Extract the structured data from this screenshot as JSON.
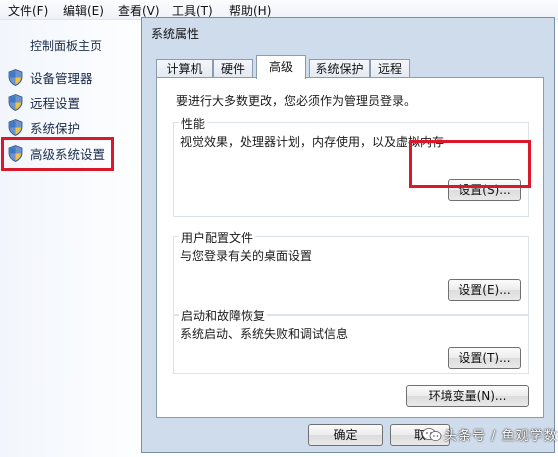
{
  "menubar": {
    "items": [
      "文件(F)",
      "编辑(E)",
      "查看(V)",
      "工具(T)",
      "帮助(H)"
    ]
  },
  "left_pane": {
    "home_label": "控制面板主页",
    "links": [
      "设备管理器",
      "远程设置",
      "系统保护",
      "高级系统设置"
    ],
    "icon": "uac-shield-icon"
  },
  "dialog": {
    "title": "系统属性",
    "tabs": [
      "计算机名",
      "硬件",
      "高级",
      "系统保护",
      "远程"
    ],
    "active_tab": "高级",
    "admin_note": "要进行大多数更改，您必须作为管理员登录。",
    "performance": {
      "title": "性能",
      "description": "视觉效果，处理器计划，内存使用，以及虚拟内存",
      "button": "设置(S)..."
    },
    "user_profiles": {
      "title": "用户配置文件",
      "description": "与您登录有关的桌面设置",
      "button": "设置(E)..."
    },
    "startup_recovery": {
      "title": "启动和故障恢复",
      "description": "系统启动、系统失败和调试信息",
      "button": "设置(T)..."
    },
    "env_button": "环境变量(N)...",
    "ok_button": "确定",
    "cancel_button_partial": "取"
  },
  "highlight_color": "#d9182b",
  "watermark": {
    "text": "头条号 / 鱼观学数控",
    "logo": "toutiao-logo-icon"
  }
}
